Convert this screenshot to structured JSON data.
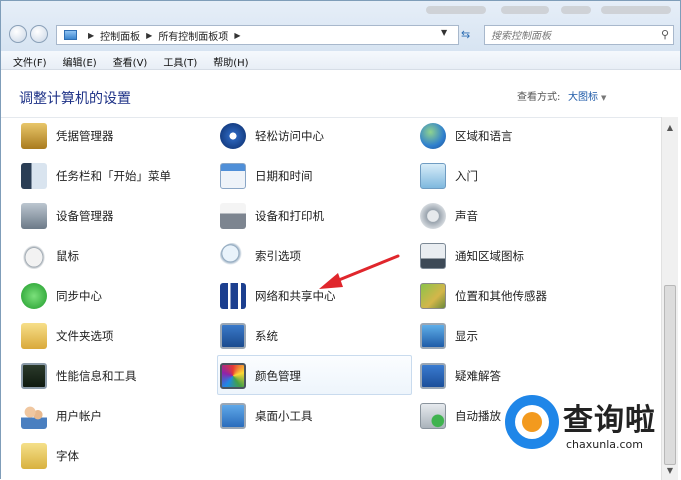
{
  "address_bar": {
    "breadcrumbs": [
      "控制面板",
      "所有控制面板项"
    ],
    "search_placeholder": "搜索控制面板"
  },
  "menubar": [
    "文件(F)",
    "编辑(E)",
    "查看(V)",
    "工具(T)",
    "帮助(H)"
  ],
  "header": {
    "title": "调整计算机的设置",
    "view_by_label": "查看方式:",
    "view_by_value": "大图标"
  },
  "items": {
    "col1": [
      "凭据管理器",
      "任务栏和「开始」菜单",
      "设备管理器",
      "鼠标",
      "同步中心",
      "文件夹选项",
      "性能信息和工具",
      "用户帐户",
      "字体"
    ],
    "col2": [
      "轻松访问中心",
      "日期和时间",
      "设备和打印机",
      "索引选项",
      "网络和共享中心",
      "系统",
      "颜色管理",
      "桌面小工具"
    ],
    "col3": [
      "区域和语言",
      "入门",
      "声音",
      "通知区域图标",
      "位置和其他传感器",
      "显示",
      "疑难解答",
      "自动播放"
    ]
  },
  "icons": {
    "col1": [
      "vault-icon",
      "taskbar-icon",
      "device-manager-icon",
      "mouse-icon",
      "sync-center-icon",
      "folder-options-icon",
      "performance-icon",
      "user-accounts-icon",
      "fonts-icon"
    ],
    "col2": [
      "ease-of-access-icon",
      "calendar-icon",
      "printer-icon",
      "indexing-icon",
      "network-icon",
      "system-icon",
      "color-management-icon",
      "gadgets-icon"
    ],
    "col3": [
      "globe-icon",
      "getting-started-icon",
      "speaker-icon",
      "notification-icon",
      "location-sensor-icon",
      "display-icon",
      "troubleshoot-icon",
      "autoplay-icon"
    ]
  },
  "watermark": {
    "brand": "查询啦",
    "url": "chaxunla.com"
  },
  "colors": {
    "annotation_arrow": "#e0262c",
    "title_blue": "#1e3287",
    "watermark_blue": "#1f86e8",
    "watermark_orange": "#f39a1e"
  }
}
